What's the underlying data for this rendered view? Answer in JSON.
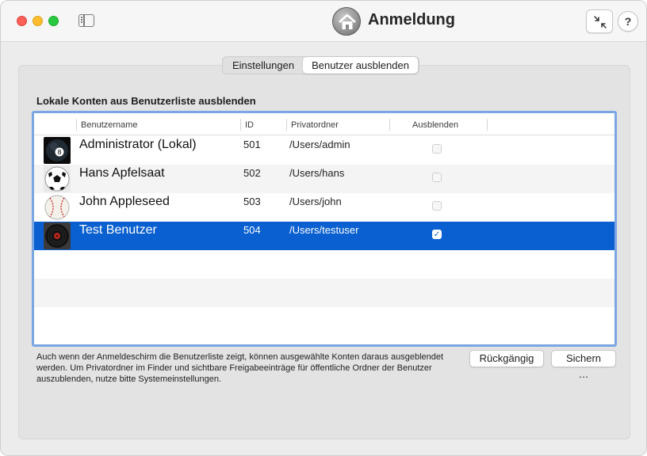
{
  "window": {
    "title": "Anmeldung",
    "help_label": "?"
  },
  "tabs": [
    {
      "label": "Einstellungen",
      "active": false
    },
    {
      "label": "Benutzer ausblenden",
      "active": true
    }
  ],
  "section": {
    "heading": "Lokale Konten aus Benutzerliste ausblenden"
  },
  "table": {
    "columns": {
      "username": "Benutzername",
      "id": "ID",
      "home": "Privatordner",
      "hide": "Ausblenden"
    },
    "rows": [
      {
        "name": "Administrator (Lokal)",
        "id": "501",
        "home": "/Users/admin",
        "hidden": false,
        "avatar": "eight-ball-icon"
      },
      {
        "name": "Hans Apfelsaat",
        "id": "502",
        "home": "/Users/hans",
        "hidden": false,
        "avatar": "soccer-ball-icon"
      },
      {
        "name": "John Appleseed",
        "id": "503",
        "home": "/Users/john",
        "hidden": false,
        "avatar": "baseball-icon"
      },
      {
        "name": "Test Benutzer",
        "id": "504",
        "home": "/Users/testuser",
        "hidden": true,
        "selected": true,
        "check_mark": "✓",
        "avatar": "vinyl-record-icon"
      }
    ]
  },
  "footnote": "Auch wenn der Anmeldeschirm die Benutzerliste zeigt, können ausgewählte Konten daraus ausgeblendet werden. Um Privatordner im Finder und sichtbare Freigabeeinträge für öffentliche Ordner der Benutzer auszublenden, nutze bitte Systemeinstellungen.",
  "buttons": {
    "undo": "Rückgängig",
    "save": "Sichern …"
  },
  "colors": {
    "selection": "#0a60d0",
    "focus_ring": "#7aa6e3"
  }
}
